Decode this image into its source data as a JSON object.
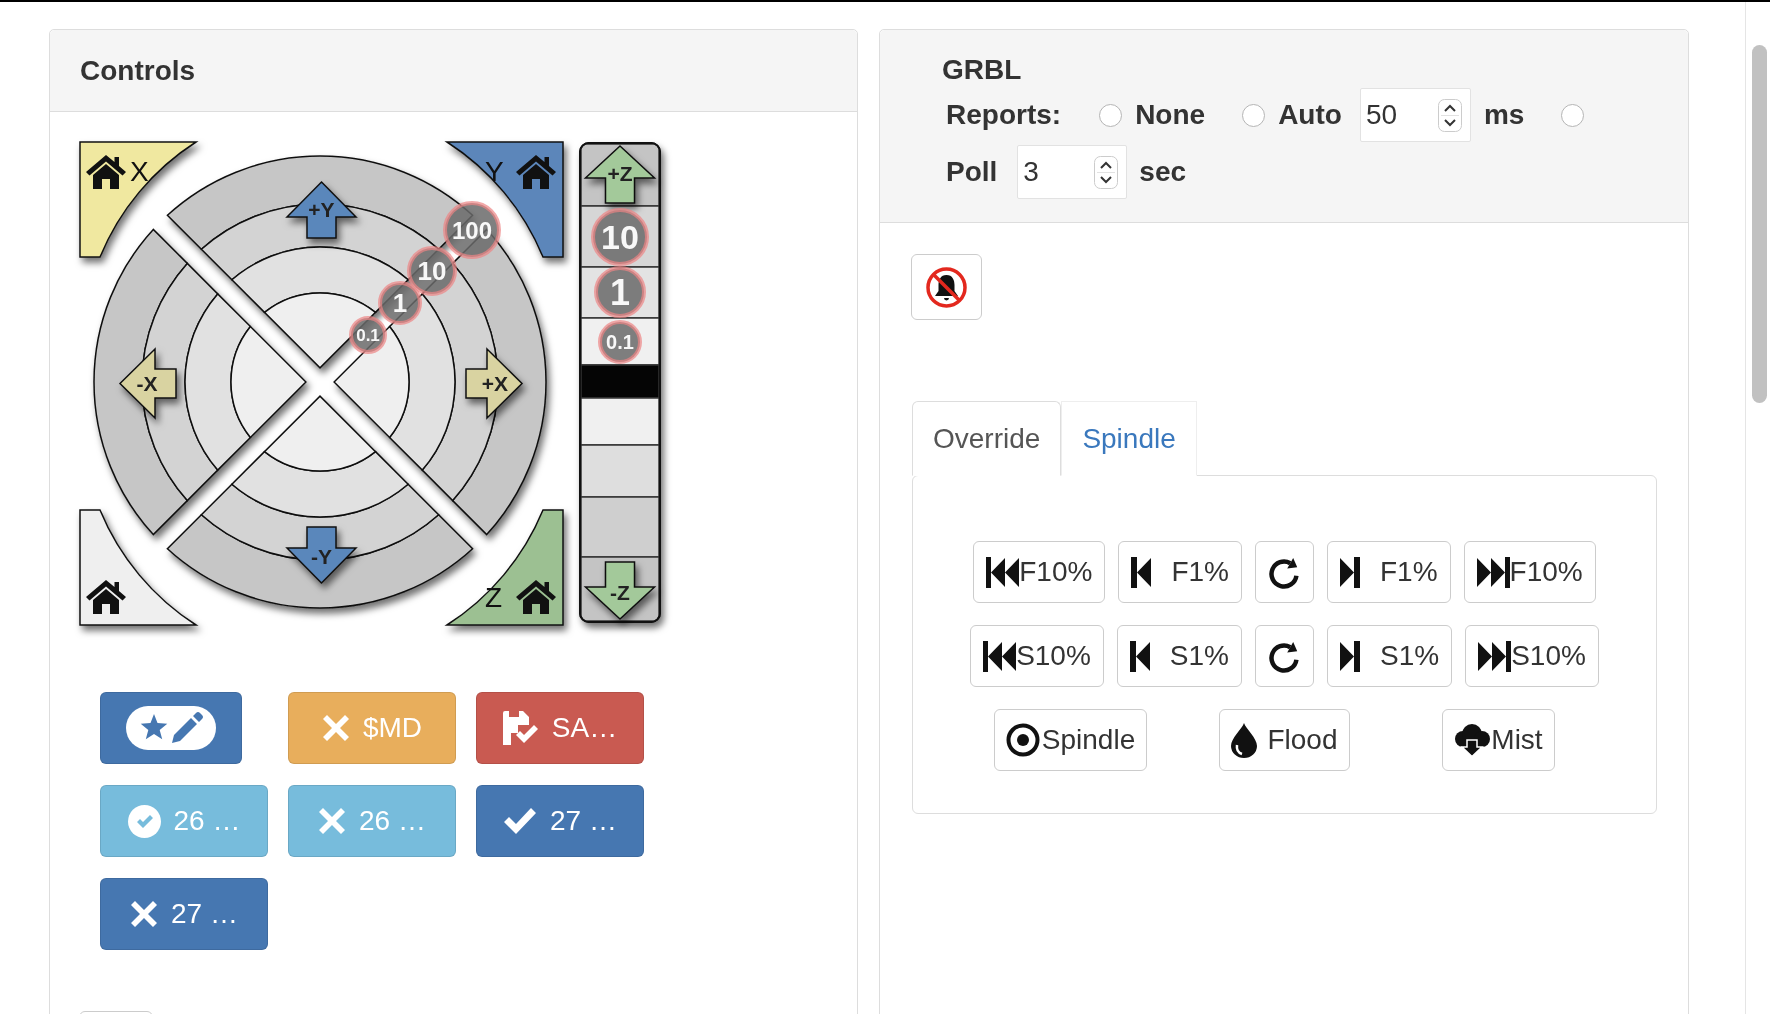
{
  "controls_panel": {
    "title": "Controls",
    "jog": {
      "home_corners": [
        {
          "label": "X",
          "color": "#f0e8a0"
        },
        {
          "label": "Y",
          "color": "#5b86ba"
        },
        {
          "label": "Z",
          "color": "#9cc092"
        },
        {
          "color": "#efefef"
        }
      ],
      "xy_arrows": [
        {
          "label": "+Y",
          "color": "#5a87bb"
        },
        {
          "label": "-X",
          "color": "#d9d3a1"
        },
        {
          "label": "+X",
          "color": "#d9d3a1"
        },
        {
          "label": "-Y",
          "color": "#5a87bb"
        }
      ],
      "xy_steps": [
        "100",
        "10",
        "1",
        "0.1"
      ],
      "z_arrows": [
        {
          "label": "+Z",
          "color": "#a3c99a"
        },
        {
          "label": "-Z",
          "color": "#a3c99a"
        }
      ],
      "z_steps": [
        "10",
        "1",
        "0.1"
      ]
    },
    "buttons": [
      {
        "kind": "edit",
        "color": "#4677b1"
      },
      {
        "kind": "cross",
        "label": "$MD",
        "color": "#e8ae5c"
      },
      {
        "kind": "save",
        "label": "SA…",
        "color": "#c95a51"
      },
      {
        "kind": "checkcircle",
        "label": "26 …",
        "color": "#77bcdc"
      },
      {
        "kind": "cross",
        "label": "26 …",
        "color": "#77bcdc"
      },
      {
        "kind": "check",
        "label": "27 …",
        "color": "#4677b1"
      },
      {
        "kind": "cross",
        "label": "27 …",
        "color": "#4677b1"
      }
    ]
  },
  "grbl_panel": {
    "title": "GRBL",
    "reports": {
      "label": "Reports:",
      "options": [
        {
          "label": "None",
          "selected": false
        },
        {
          "label": "Auto",
          "selected": false,
          "value": "50",
          "unit": "ms"
        },
        {
          "label": "Poll",
          "selected": false,
          "value": "3",
          "unit": "sec"
        }
      ]
    },
    "sound_button": {
      "muted": true
    },
    "tabs": [
      {
        "label": "Override",
        "selected": true
      },
      {
        "label": "Spindle",
        "selected": false
      }
    ],
    "override_rows": [
      [
        {
          "kind": "fastback",
          "label": "F10%"
        },
        {
          "kind": "back",
          "label": "F1%"
        },
        {
          "kind": "reset"
        },
        {
          "kind": "forward",
          "label": "F1%"
        },
        {
          "kind": "fastforward",
          "label": "F10%"
        }
      ],
      [
        {
          "kind": "fastback",
          "label": "S10%"
        },
        {
          "kind": "back",
          "label": "S1%"
        },
        {
          "kind": "reset"
        },
        {
          "kind": "forward",
          "label": "S1%"
        },
        {
          "kind": "fastforward",
          "label": "S10%"
        }
      ]
    ],
    "coolant_buttons": [
      {
        "kind": "spindle",
        "label": "Spindle"
      },
      {
        "kind": "flood",
        "label": "Flood"
      },
      {
        "kind": "mist",
        "label": "Mist"
      }
    ]
  }
}
